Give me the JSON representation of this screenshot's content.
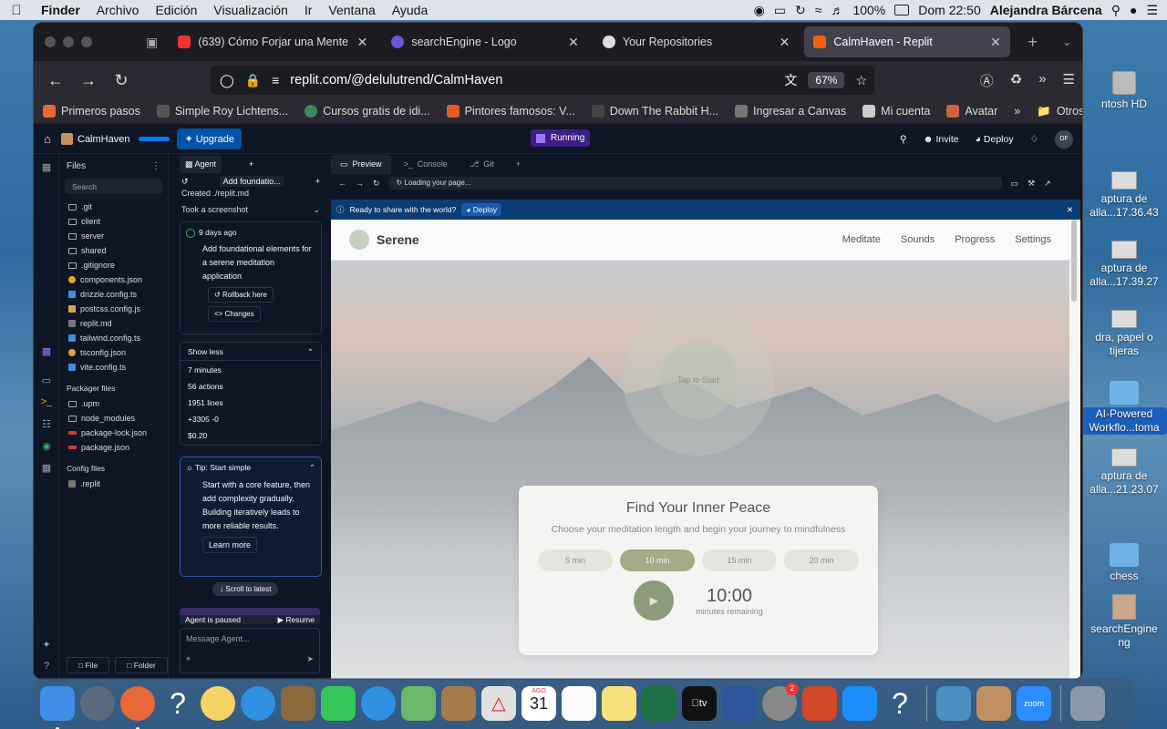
{
  "menubar": {
    "app": "Finder",
    "items": [
      "Archivo",
      "Edición",
      "Visualización",
      "Ir",
      "Ventana",
      "Ayuda"
    ],
    "battery": "100%",
    "clock": "Dom 22:50",
    "user": "Alejandra Bárcena"
  },
  "desktop": {
    "items": [
      {
        "label": "ntosh HD"
      },
      {
        "label": "aptura de\nalla...17.36.43"
      },
      {
        "label": "aptura de\nalla...17.39.27"
      },
      {
        "label": "dra, papel o\ntijeras"
      },
      {
        "label": "AI-Powered\nWorkflo...toma"
      },
      {
        "label": "aptura de\nalla...21.23.07"
      },
      {
        "label": "chess"
      },
      {
        "label": "searchEngine\nng"
      }
    ]
  },
  "browser": {
    "tabs": [
      {
        "title": "(639) Cómo Forjar una Mente D",
        "color": "#e33"
      },
      {
        "title": "searchEngine - Logo",
        "color": "#6a55d8"
      },
      {
        "title": "Your Repositories",
        "color": "#ddd"
      },
      {
        "title": "CalmHaven - Replit",
        "color": "#f26207"
      }
    ],
    "url": "replit.com/@delulutrend/CalmHaven",
    "zoom": "67%",
    "bookmarks": [
      "Primeros pasos",
      "Simple Roy Lichtens...",
      "Cursos gratis de idi...",
      "Pintores famosos: V...",
      "Down The Rabbit H...",
      "Ingresar a Canvas",
      "Mi cuenta",
      "Avatar"
    ],
    "other_bookmarks": "Otros marcadores"
  },
  "replit": {
    "project": "CalmHaven",
    "upgrade": "Upgrade",
    "running": "Running",
    "invite": "Invite",
    "deploy": "Deploy",
    "avatar": "DF",
    "files_title": "Files",
    "search": "Search",
    "files": [
      {
        "name": ".git",
        "t": "folder"
      },
      {
        "name": "client",
        "t": "folder"
      },
      {
        "name": "server",
        "t": "folder"
      },
      {
        "name": "shared",
        "t": "folder"
      },
      {
        "name": ".gitignore",
        "t": "file"
      },
      {
        "name": "components.json",
        "t": "json"
      },
      {
        "name": "drizzle.config.ts",
        "t": "ts"
      },
      {
        "name": "postcss.config.js",
        "t": "js"
      },
      {
        "name": "replit.md",
        "t": "md"
      },
      {
        "name": "tailwind.config.ts",
        "t": "ts"
      },
      {
        "name": "tsconfig.json",
        "t": "json"
      },
      {
        "name": "vite.config.ts",
        "t": "ts"
      }
    ],
    "packager_title": "Packager files",
    "packager": [
      {
        "name": ".upm",
        "t": "folder"
      },
      {
        "name": "node_modules",
        "t": "folder"
      },
      {
        "name": "package-lock.json",
        "t": "pkg"
      },
      {
        "name": "package.json",
        "t": "pkg"
      }
    ],
    "config_title": "Config files",
    "config": [
      {
        "name": ".replit",
        "t": "replit"
      }
    ],
    "file_btn": "File",
    "folder_btn": "Folder",
    "agent": {
      "tab": "Agent",
      "history": "Add foundatio...",
      "created": "Created ./replit.md",
      "screenshot": "Took a screenshot",
      "time_ago": "9 days ago",
      "message": "Add foundational elements for a serene meditation application",
      "rollback": "Rollback here",
      "changes": "Changes",
      "show_less": "Show less",
      "stats": [
        "7 minutes",
        "56 actions",
        "1951 lines",
        "+3305 -0",
        "$0.20"
      ],
      "tip_title": "Tip: Start simple",
      "tip_text": "Start with a core feature, then add complexity gradually. Building iteratively leads to more reliable results.",
      "learn_more": "Learn more",
      "scroll_latest": "Scroll to latest",
      "paused": "Agent is paused",
      "resume": "Resume",
      "message_placeholder": "Message Agent..."
    },
    "preview": {
      "tabs": [
        "Preview",
        "Console",
        "Git"
      ],
      "loading": "Loading your page...",
      "banner": "Ready to share with the world?",
      "banner_deploy": "Deploy"
    }
  },
  "serene": {
    "brand": "Serene",
    "nav": [
      "Meditate",
      "Sounds",
      "Progress",
      "Settings"
    ],
    "tap": "Tap to Start",
    "title": "Find Your Inner Peace",
    "subtitle": "Choose your meditation length and begin your journey to mindfulness",
    "durations": [
      "5 min",
      "10 min",
      "15 min",
      "20 min"
    ],
    "selected_duration": "10 min",
    "timer": "10:00",
    "timer_sub": "minutes remaining"
  },
  "dock": {
    "calendar_month": "AGO",
    "calendar_day": "31",
    "settings_badge": "2",
    "zoom_label": "zoom"
  }
}
